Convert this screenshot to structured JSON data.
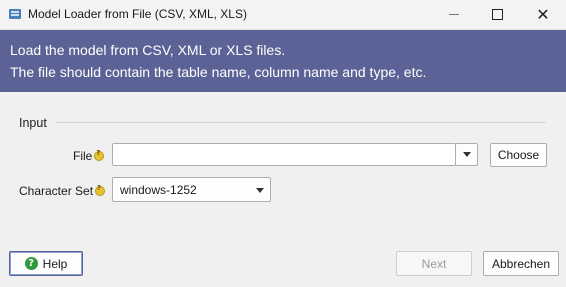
{
  "window": {
    "title": "Model Loader from File (CSV, XML, XLS)",
    "icon": "app-icon",
    "controls": [
      "minimize-icon",
      "maximize-icon",
      "close-icon"
    ]
  },
  "banner": {
    "line1": "Load the model from CSV, XML or XLS files.",
    "line2": "The file should contain the table name, column name and type, etc.",
    "background": "#5b6396"
  },
  "input_group": {
    "title": "Input",
    "file": {
      "label": "File",
      "value": "",
      "choose_label": "Choose"
    },
    "charset": {
      "label": "Character Set",
      "value": "windows-1252"
    }
  },
  "footer": {
    "help_label": "Help",
    "next_label": "Next",
    "cancel_label": "Abbrechen"
  },
  "colors": {
    "hint": "#e8c331",
    "help_icon": "#2f9a3a"
  }
}
